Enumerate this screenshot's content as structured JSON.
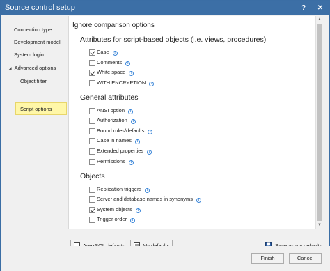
{
  "window": {
    "title": "Source control setup",
    "help_glyph": "?",
    "close_glyph": "✕"
  },
  "sidebar": {
    "items": [
      {
        "label": "Connection type"
      },
      {
        "label": "Development model"
      },
      {
        "label": "System login"
      },
      {
        "label": "Advanced options"
      },
      {
        "label": "Object filter"
      },
      {
        "label": "Script options"
      }
    ],
    "selected": "Script options"
  },
  "content": {
    "heading": "Ignore comparison options",
    "groups": [
      {
        "title": "Attributes for script-based objects (i.e. views, procedures)",
        "options": [
          {
            "label": "Case",
            "checked": true
          },
          {
            "label": "Comments",
            "checked": false
          },
          {
            "label": "White space",
            "checked": true
          },
          {
            "label": "WITH ENCRYPTION",
            "checked": false
          }
        ]
      },
      {
        "title": "General attributes",
        "options": [
          {
            "label": "ANSI option",
            "checked": false
          },
          {
            "label": "Authorization",
            "checked": false
          },
          {
            "label": "Bound rules/defaults",
            "checked": false
          },
          {
            "label": "Case in names",
            "checked": false
          },
          {
            "label": "Extended properties",
            "checked": false
          },
          {
            "label": "Permissions",
            "checked": false
          }
        ]
      },
      {
        "title": "Objects",
        "options": [
          {
            "label": "Replication triggers",
            "checked": false
          },
          {
            "label": "Server and database names in synonyms",
            "checked": false
          },
          {
            "label": "System objects",
            "checked": true
          },
          {
            "label": "Trigger order",
            "checked": false
          }
        ]
      }
    ]
  },
  "defaults_buttons": {
    "apexsql_label": "ApexSQL defaults",
    "my_label": "My defaults",
    "save_label": "Save as my defaults"
  },
  "dialog_buttons": {
    "finish_label": "Finish",
    "cancel_label": "Cancel"
  },
  "colors": {
    "titlebar": "#3c6fa6",
    "selected_nav": "#fff7a8",
    "info_icon": "#3b86d8"
  }
}
